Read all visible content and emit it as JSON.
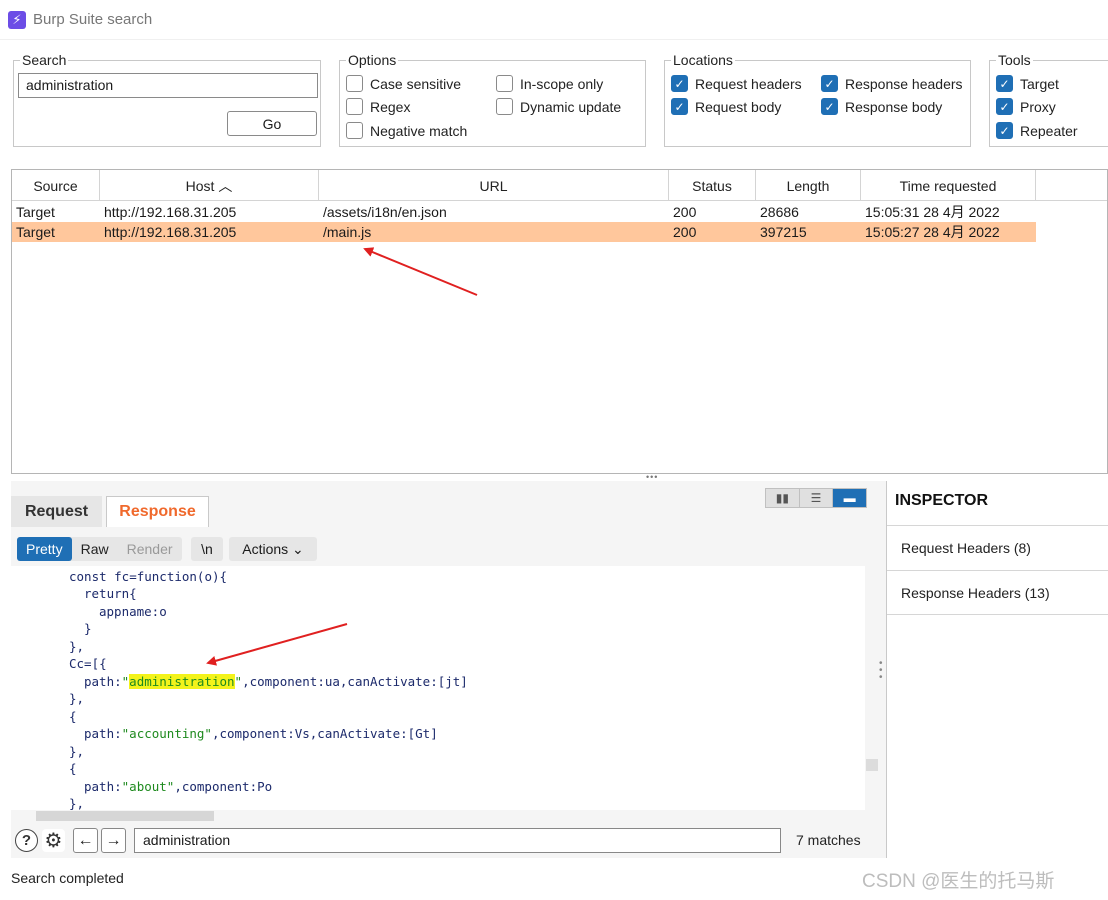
{
  "window": {
    "title": "Burp Suite search",
    "logo_glyph": "⚡"
  },
  "search": {
    "legend": "Search",
    "value": "administration",
    "go_label": "Go"
  },
  "options": {
    "legend": "Options",
    "case_sensitive": "Case sensitive",
    "in_scope_only": "In-scope only",
    "regex": "Regex",
    "dynamic_update": "Dynamic update",
    "negative_match": "Negative match"
  },
  "locations": {
    "legend": "Locations",
    "request_headers": "Request headers",
    "response_headers": "Response headers",
    "request_body": "Request body",
    "response_body": "Response body"
  },
  "tools": {
    "legend": "Tools",
    "target": "Target",
    "proxy": "Proxy",
    "repeater": "Repeater"
  },
  "table": {
    "columns": [
      "Source",
      "Host ︿",
      "URL",
      "Status",
      "Length",
      "Time requested"
    ],
    "rows": [
      {
        "source": "Target",
        "host": "http://192.168.31.205",
        "url": "/assets/i18n/en.json",
        "status": "200",
        "length": "28686",
        "time": "15:05:31 28 4月 2022"
      },
      {
        "source": "Target",
        "host": "http://192.168.31.205",
        "url": "/main.js",
        "status": "200",
        "length": "397215",
        "time": "15:05:27 28 4月 2022"
      }
    ]
  },
  "tabs": {
    "request": "Request",
    "response": "Response"
  },
  "view_toggle": [
    "▮▮",
    "☰",
    "▬"
  ],
  "format": {
    "pretty": "Pretty",
    "raw": "Raw",
    "render": "Render",
    "newline": "\\n",
    "actions": "Actions ⌄"
  },
  "code": {
    "l1": "const fc=function(o){",
    "l2": "return{",
    "l3": "appname:o",
    "l4": "}",
    "l5": "},",
    "l6": "Cc=[{",
    "l7_a": "path:",
    "l7_q1": "\"",
    "l7_hl": "administration",
    "l7_q2": "\"",
    "l7_b": ",component:ua,canActivate:[jt]",
    "l8": "},",
    "l9": "{",
    "l10_a": "path:",
    "l10_s": "\"accounting\"",
    "l10_b": ",component:Vs,canActivate:[Gt]",
    "l11": "},",
    "l12": "{",
    "l13_a": "path:",
    "l13_s": "\"about\"",
    "l13_b": ",component:Po",
    "l14": "},"
  },
  "find": {
    "help": "?",
    "settings": "⚙",
    "prev": "←",
    "next": "→",
    "value": "administration",
    "matches": "7 matches"
  },
  "inspector": {
    "title": "INSPECTOR",
    "request_headers": "Request Headers (8)",
    "response_headers": "Response Headers (13)"
  },
  "status": "Search completed",
  "watermark": "CSDN @医生的托马斯",
  "colors": {
    "selected_row": "#ffc79c",
    "accent_blue": "#1f6fb5",
    "response_tab": "#f0692c",
    "highlight": "#f3f31b",
    "annotation_arrow": "#e02020"
  }
}
